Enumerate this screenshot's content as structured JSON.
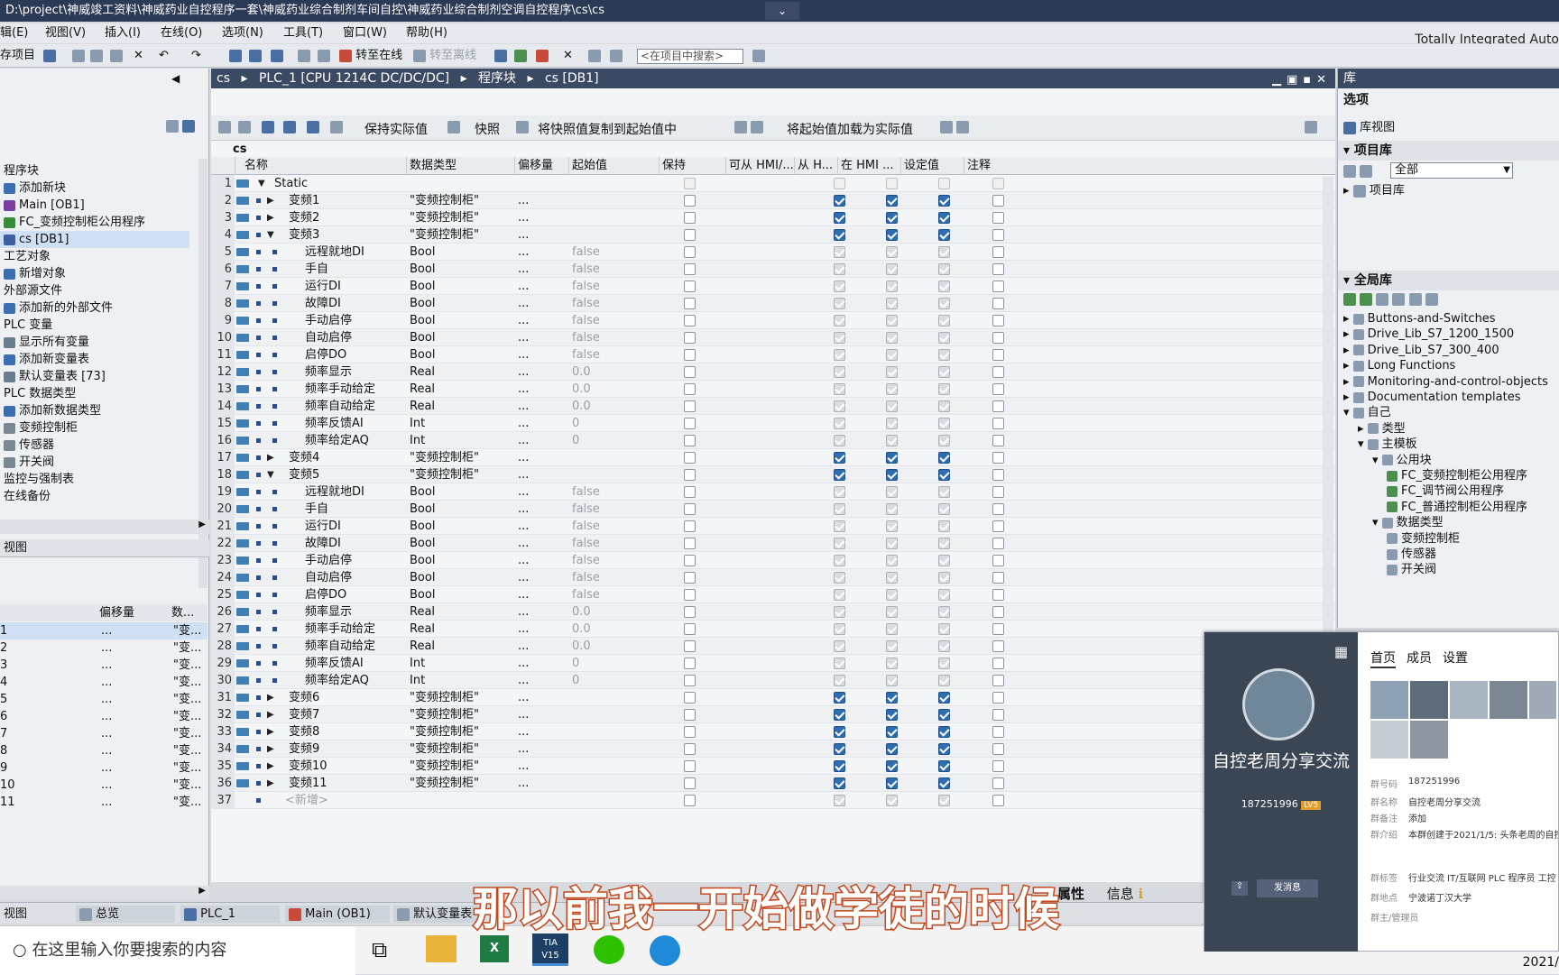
{
  "window": {
    "title": "D:\\project\\神威竣工资料\\神威药业自控程序一套\\神威药业综合制剂车间自控\\神威药业综合制剂空调自控程序\\cs\\cs",
    "chevron": "⌄"
  },
  "menu": [
    "辑(E)",
    "视图(V)",
    "插入(I)",
    "在线(O)",
    "选项(N)",
    "工具(T)",
    "窗口(W)",
    "帮助(H)"
  ],
  "brand": "Totally Integrated Auto",
  "toolbar": {
    "save": "存项目",
    "go_online": "转至在线",
    "go_offline": "转至离线",
    "search_placeholder": "<在项目中搜索>"
  },
  "breadcrumb": [
    "cs",
    "PLC_1 [CPU 1214C DC/DC/DC]",
    "程序块",
    "cs [DB1]"
  ],
  "editor_toolbar": {
    "keep": "保持实际值",
    "snapshot": "快照",
    "copy_snapshot": "将快照值复制到起始值中",
    "load_start": "将起始值加载为实际值"
  },
  "block_name": "cs",
  "columns": [
    "名称",
    "数据类型",
    "偏移量",
    "起始值",
    "保持",
    "可从 HMI/...",
    "从 H...",
    "在 HMI ...",
    "设定值",
    "注释"
  ],
  "rows": [
    {
      "n": "1",
      "name": "Static",
      "type": "",
      "off": "",
      "start": "",
      "lvl": 0,
      "exp": "▼",
      "cb": "n"
    },
    {
      "n": "2",
      "name": "变频1",
      "type": "\"变频控制柜\"",
      "off": "...",
      "start": "",
      "lvl": 1,
      "exp": "▶",
      "cb": "a"
    },
    {
      "n": "3",
      "name": "变频2",
      "type": "\"变频控制柜\"",
      "off": "...",
      "start": "",
      "lvl": 1,
      "exp": "▶",
      "cb": "a"
    },
    {
      "n": "4",
      "name": "变频3",
      "type": "\"变频控制柜\"",
      "off": "...",
      "start": "",
      "lvl": 1,
      "exp": "▼",
      "cb": "a"
    },
    {
      "n": "5",
      "name": "远程就地DI",
      "type": "Bool",
      "off": "...",
      "start": "false",
      "lvl": 2,
      "exp": "",
      "cb": "d"
    },
    {
      "n": "6",
      "name": "手自",
      "type": "Bool",
      "off": "...",
      "start": "false",
      "lvl": 2,
      "exp": "",
      "cb": "d"
    },
    {
      "n": "7",
      "name": "运行DI",
      "type": "Bool",
      "off": "...",
      "start": "false",
      "lvl": 2,
      "exp": "",
      "cb": "d"
    },
    {
      "n": "8",
      "name": "故障DI",
      "type": "Bool",
      "off": "...",
      "start": "false",
      "lvl": 2,
      "exp": "",
      "cb": "d"
    },
    {
      "n": "9",
      "name": "手动启停",
      "type": "Bool",
      "off": "...",
      "start": "false",
      "lvl": 2,
      "exp": "",
      "cb": "d"
    },
    {
      "n": "10",
      "name": "自动启停",
      "type": "Bool",
      "off": "...",
      "start": "false",
      "lvl": 2,
      "exp": "",
      "cb": "d"
    },
    {
      "n": "11",
      "name": "启停DO",
      "type": "Bool",
      "off": "...",
      "start": "false",
      "lvl": 2,
      "exp": "",
      "cb": "d"
    },
    {
      "n": "12",
      "name": "频率显示",
      "type": "Real",
      "off": "...",
      "start": "0.0",
      "lvl": 2,
      "exp": "",
      "cb": "d"
    },
    {
      "n": "13",
      "name": "频率手动给定",
      "type": "Real",
      "off": "...",
      "start": "0.0",
      "lvl": 2,
      "exp": "",
      "cb": "d"
    },
    {
      "n": "14",
      "name": "频率自动给定",
      "type": "Real",
      "off": "...",
      "start": "0.0",
      "lvl": 2,
      "exp": "",
      "cb": "d"
    },
    {
      "n": "15",
      "name": "频率反馈AI",
      "type": "Int",
      "off": "...",
      "start": "0",
      "lvl": 2,
      "exp": "",
      "cb": "d"
    },
    {
      "n": "16",
      "name": "频率给定AQ",
      "type": "Int",
      "off": "...",
      "start": "0",
      "lvl": 2,
      "exp": "",
      "cb": "d"
    },
    {
      "n": "17",
      "name": "变频4",
      "type": "\"变频控制柜\"",
      "off": "...",
      "start": "",
      "lvl": 1,
      "exp": "▶",
      "cb": "a"
    },
    {
      "n": "18",
      "name": "变频5",
      "type": "\"变频控制柜\"",
      "off": "...",
      "start": "",
      "lvl": 1,
      "exp": "▼",
      "cb": "a"
    },
    {
      "n": "19",
      "name": "远程就地DI",
      "type": "Bool",
      "off": "...",
      "start": "false",
      "lvl": 2,
      "exp": "",
      "cb": "d"
    },
    {
      "n": "20",
      "name": "手自",
      "type": "Bool",
      "off": "...",
      "start": "false",
      "lvl": 2,
      "exp": "",
      "cb": "d"
    },
    {
      "n": "21",
      "name": "运行DI",
      "type": "Bool",
      "off": "...",
      "start": "false",
      "lvl": 2,
      "exp": "",
      "cb": "d"
    },
    {
      "n": "22",
      "name": "故障DI",
      "type": "Bool",
      "off": "...",
      "start": "false",
      "lvl": 2,
      "exp": "",
      "cb": "d"
    },
    {
      "n": "23",
      "name": "手动启停",
      "type": "Bool",
      "off": "...",
      "start": "false",
      "lvl": 2,
      "exp": "",
      "cb": "d"
    },
    {
      "n": "24",
      "name": "自动启停",
      "type": "Bool",
      "off": "...",
      "start": "false",
      "lvl": 2,
      "exp": "",
      "cb": "d"
    },
    {
      "n": "25",
      "name": "启停DO",
      "type": "Bool",
      "off": "...",
      "start": "false",
      "lvl": 2,
      "exp": "",
      "cb": "d"
    },
    {
      "n": "26",
      "name": "频率显示",
      "type": "Real",
      "off": "...",
      "start": "0.0",
      "lvl": 2,
      "exp": "",
      "cb": "d"
    },
    {
      "n": "27",
      "name": "频率手动给定",
      "type": "Real",
      "off": "...",
      "start": "0.0",
      "lvl": 2,
      "exp": "",
      "cb": "d"
    },
    {
      "n": "28",
      "name": "频率自动给定",
      "type": "Real",
      "off": "...",
      "start": "0.0",
      "lvl": 2,
      "exp": "",
      "cb": "d"
    },
    {
      "n": "29",
      "name": "频率反馈AI",
      "type": "Int",
      "off": "...",
      "start": "0",
      "lvl": 2,
      "exp": "",
      "cb": "d"
    },
    {
      "n": "30",
      "name": "频率给定AQ",
      "type": "Int",
      "off": "...",
      "start": "0",
      "lvl": 2,
      "exp": "",
      "cb": "d"
    },
    {
      "n": "31",
      "name": "变频6",
      "type": "\"变频控制柜\"",
      "off": "...",
      "start": "",
      "lvl": 1,
      "exp": "▶",
      "cb": "a"
    },
    {
      "n": "32",
      "name": "变频7",
      "type": "\"变频控制柜\"",
      "off": "...",
      "start": "",
      "lvl": 1,
      "exp": "▶",
      "cb": "a"
    },
    {
      "n": "33",
      "name": "变频8",
      "type": "\"变频控制柜\"",
      "off": "...",
      "start": "",
      "lvl": 1,
      "exp": "▶",
      "cb": "a"
    },
    {
      "n": "34",
      "name": "变频9",
      "type": "\"变频控制柜\"",
      "off": "...",
      "start": "",
      "lvl": 1,
      "exp": "▶",
      "cb": "a"
    },
    {
      "n": "35",
      "name": "变频10",
      "type": "\"变频控制柜\"",
      "off": "...",
      "start": "",
      "lvl": 1,
      "exp": "▶",
      "cb": "a"
    },
    {
      "n": "36",
      "name": "变频11",
      "type": "\"变频控制柜\"",
      "off": "...",
      "start": "",
      "lvl": 1,
      "exp": "▶",
      "cb": "a"
    },
    {
      "n": "37",
      "name": "<新增>",
      "type": "",
      "off": "",
      "start": "",
      "lvl": 1,
      "exp": "",
      "cb": "d"
    }
  ],
  "project_tree": [
    {
      "label": "程序块",
      "icon": "folder",
      "indent": 0
    },
    {
      "label": "添加新块",
      "icon": "add",
      "indent": 1
    },
    {
      "label": "Main [OB1]",
      "icon": "ob",
      "indent": 1
    },
    {
      "label": "FC_变频控制柜公用程序",
      "icon": "fc",
      "indent": 1
    },
    {
      "label": "cs [DB1]",
      "icon": "db",
      "indent": 1,
      "sel": true
    },
    {
      "label": "工艺对象",
      "icon": "folder",
      "indent": 0
    },
    {
      "label": "新增对象",
      "icon": "add",
      "indent": 1
    },
    {
      "label": "外部源文件",
      "icon": "folder",
      "indent": 0
    },
    {
      "label": "添加新的外部文件",
      "icon": "add",
      "indent": 1
    },
    {
      "label": "PLC 变量",
      "icon": "folder",
      "indent": 0
    },
    {
      "label": "显示所有变量",
      "icon": "tag",
      "indent": 1
    },
    {
      "label": "添加新变量表",
      "icon": "add",
      "indent": 1
    },
    {
      "label": "默认变量表 [73]",
      "icon": "tag",
      "indent": 1
    },
    {
      "label": "PLC 数据类型",
      "icon": "folder",
      "indent": 0
    },
    {
      "label": "添加新数据类型",
      "icon": "add",
      "indent": 1
    },
    {
      "label": "变频控制柜",
      "icon": "udt",
      "indent": 1
    },
    {
      "label": "传感器",
      "icon": "udt",
      "indent": 1
    },
    {
      "label": "开关阀",
      "icon": "udt",
      "indent": 1
    },
    {
      "label": "监控与强制表",
      "icon": "folder",
      "indent": 0
    },
    {
      "label": "在线备份",
      "icon": "folder",
      "indent": 0
    }
  ],
  "detail_view": {
    "title": "视图",
    "col_offset": "偏移量",
    "col_data": "数...",
    "rows": [
      {
        "name": "1",
        "off": "...",
        "val": "\"变..."
      },
      {
        "name": "2",
        "off": "...",
        "val": "\"变..."
      },
      {
        "name": "3",
        "off": "...",
        "val": "\"变..."
      },
      {
        "name": "4",
        "off": "...",
        "val": "\"变..."
      },
      {
        "name": "5",
        "off": "...",
        "val": "\"变..."
      },
      {
        "name": "6",
        "off": "...",
        "val": "\"变..."
      },
      {
        "name": "7",
        "off": "...",
        "val": "\"变..."
      },
      {
        "name": "8",
        "off": "...",
        "val": "\"变..."
      },
      {
        "name": "9",
        "off": "...",
        "val": "\"变..."
      },
      {
        "name": "10",
        "off": "...",
        "val": "\"变..."
      },
      {
        "name": "11",
        "off": "...",
        "val": "\"变..."
      }
    ]
  },
  "library": {
    "title": "库",
    "options": "选项",
    "lib_view": "库视图",
    "project_lib": "项目库",
    "all": "全部",
    "project_lib_item": "项目库",
    "global_lib": "全局库",
    "global_items": [
      {
        "label": "Buttons-and-Switches",
        "indent": 0
      },
      {
        "label": "Drive_Lib_S7_1200_1500",
        "indent": 0
      },
      {
        "label": "Drive_Lib_S7_300_400",
        "indent": 0
      },
      {
        "label": "Long Functions",
        "indent": 0
      },
      {
        "label": "Monitoring-and-control-objects",
        "indent": 0
      },
      {
        "label": "Documentation templates",
        "indent": 0
      },
      {
        "label": "自己",
        "indent": 0
      },
      {
        "label": "类型",
        "indent": 1
      },
      {
        "label": "主模板",
        "indent": 1
      },
      {
        "label": "公用块",
        "indent": 2
      },
      {
        "label": "FC_变频控制柜公用程序",
        "indent": 3
      },
      {
        "label": "FC_调节阀公用程序",
        "indent": 3
      },
      {
        "label": "FC_普通控制柜公用程序",
        "indent": 3
      },
      {
        "label": "数据类型",
        "indent": 2
      },
      {
        "label": "变频控制柜",
        "indent": 3
      },
      {
        "label": "传感器",
        "indent": 3
      },
      {
        "label": "开关阀",
        "indent": 3
      }
    ]
  },
  "popup": {
    "group_name": "自控老周分享交流",
    "group_id": "187251996",
    "level": "LV5",
    "tabs": [
      "首页",
      "成员",
      "设置"
    ],
    "send_button": "发消息",
    "info": [
      {
        "k": "群号码",
        "v": "187251996"
      },
      {
        "k": "群名称",
        "v": "自控老周分享交流"
      },
      {
        "k": "群备注",
        "v": "添加"
      },
      {
        "k": "群介绍",
        "v": "本群创建于2021/1/5: 头条老周的自控..."
      },
      {
        "k": "群标签",
        "v": "行业交流  IT/互联网  PLC  程序员  工控"
      },
      {
        "k": "群地点",
        "v": "宁波诺丁汉大学"
      },
      {
        "k": "群主/管理员",
        "v": ""
      }
    ]
  },
  "bottom_tabs": [
    "视图",
    "总览",
    "PLC_1",
    "Main (OB1)",
    "默认变量表"
  ],
  "properties": "属性",
  "info": "信息",
  "taskbar": {
    "search": "在这里输入你要搜索的内容",
    "clock": "2021/"
  },
  "subtitle": "那以前我一开始做学徒的时候"
}
